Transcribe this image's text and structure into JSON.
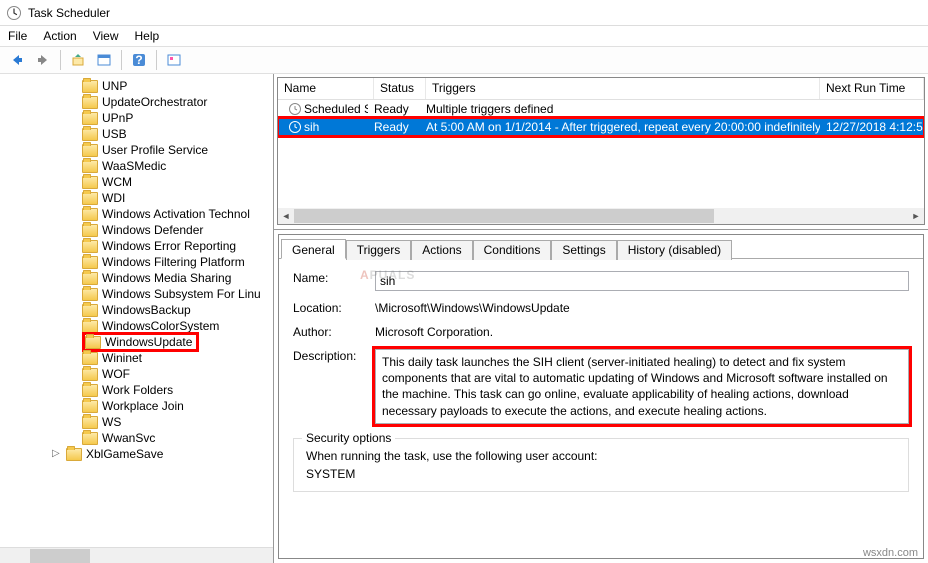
{
  "window": {
    "title": "Task Scheduler"
  },
  "menu": {
    "file": "File",
    "action": "Action",
    "view": "View",
    "help": "Help"
  },
  "tree": {
    "items": [
      {
        "label": "UNP"
      },
      {
        "label": "UpdateOrchestrator"
      },
      {
        "label": "UPnP"
      },
      {
        "label": "USB"
      },
      {
        "label": "User Profile Service"
      },
      {
        "label": "WaaSMedic"
      },
      {
        "label": "WCM"
      },
      {
        "label": "WDI"
      },
      {
        "label": "Windows Activation Technol"
      },
      {
        "label": "Windows Defender"
      },
      {
        "label": "Windows Error Reporting"
      },
      {
        "label": "Windows Filtering Platform"
      },
      {
        "label": "Windows Media Sharing"
      },
      {
        "label": "Windows Subsystem For Linu"
      },
      {
        "label": "WindowsBackup"
      },
      {
        "label": "WindowsColorSystem"
      },
      {
        "label": "WindowsUpdate",
        "highlight": true
      },
      {
        "label": "Wininet"
      },
      {
        "label": "WOF"
      },
      {
        "label": "Work Folders"
      },
      {
        "label": "Workplace Join"
      },
      {
        "label": "WS"
      },
      {
        "label": "WwanSvc"
      }
    ],
    "last": {
      "label": "XblGameSave"
    }
  },
  "tasklist": {
    "columns": {
      "name": "Name",
      "status": "Status",
      "triggers": "Triggers",
      "nextrun": "Next Run Time"
    },
    "rows": [
      {
        "name": "Scheduled S...",
        "status": "Ready",
        "triggers": "Multiple triggers defined",
        "nextrun": ""
      },
      {
        "name": "sih",
        "status": "Ready",
        "triggers": "At 5:00 AM on 1/1/2014 - After triggered, repeat every 20:00:00 indefinitely.",
        "nextrun": "12/27/2018 4:12:5",
        "selected": true
      }
    ]
  },
  "tabs": {
    "general": "General",
    "triggers": "Triggers",
    "actions": "Actions",
    "conditions": "Conditions",
    "settings": "Settings",
    "history": "History (disabled)"
  },
  "general": {
    "labels": {
      "name": "Name:",
      "location": "Location:",
      "author": "Author:",
      "description": "Description:"
    },
    "name": "sih",
    "location": "\\Microsoft\\Windows\\WindowsUpdate",
    "author": "Microsoft Corporation.",
    "description": "This daily task launches the SIH client (server-initiated healing) to detect and fix system components that are vital to automatic updating of Windows and Microsoft software installed on the machine. This task can go online, evaluate applicability of healing actions, download necessary payloads to execute the actions, and execute healing actions."
  },
  "security": {
    "legend": "Security options",
    "line1": "When running the task, use the following user account:",
    "account": "SYSTEM"
  },
  "watermark": {
    "prefix": "A",
    "suffix": "PUALS"
  },
  "footer": "wsxdn.com"
}
